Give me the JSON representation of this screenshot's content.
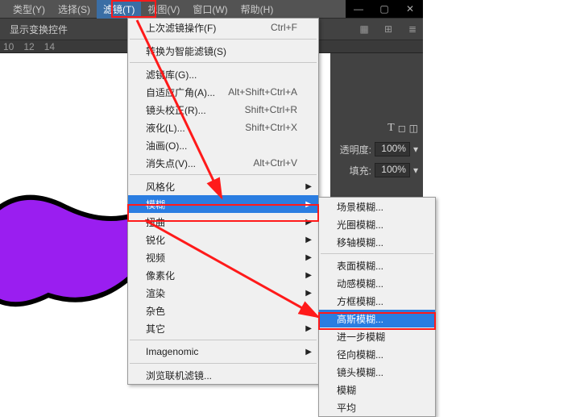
{
  "menubar": {
    "items": [
      {
        "label": "类型(Y)"
      },
      {
        "label": "选择(S)"
      },
      {
        "label": "滤镜(T)"
      },
      {
        "label": "视图(V)"
      },
      {
        "label": "窗口(W)"
      },
      {
        "label": "帮助(H)"
      }
    ]
  },
  "toolbar": {
    "label": "显示变换控件"
  },
  "ruler": {
    "marks": [
      "10",
      "12",
      "14"
    ]
  },
  "rightpanel": {
    "type_label": "T",
    "opacity_label": "透明度:",
    "opacity_value": "100%",
    "fill_label": "填充:",
    "fill_value": "100%"
  },
  "filter_menu": {
    "last_op": "上次滤镜操作(F)",
    "last_op_shortcut": "Ctrl+F",
    "smart": "转换为智能滤镜(S)",
    "gallery": "滤镜库(G)...",
    "wide": "自适应广角(A)...",
    "wide_s": "Alt+Shift+Ctrl+A",
    "lens": "镜头校正(R)...",
    "lens_s": "Shift+Ctrl+R",
    "liquify": "液化(L)...",
    "liquify_s": "Shift+Ctrl+X",
    "oil": "油画(O)...",
    "vanish": "消失点(V)...",
    "vanish_s": "Alt+Ctrl+V",
    "stylize": "风格化",
    "blur": "模糊",
    "distort": "扭曲",
    "sharpen": "锐化",
    "video": "视频",
    "pixelate": "像素化",
    "render": "渲染",
    "noise": "杂色",
    "other": "其它",
    "imagenomic": "Imagenomic",
    "browse": "浏览联机滤镜..."
  },
  "blur_menu": {
    "field": "场景模糊...",
    "iris": "光圈模糊...",
    "tilt": "移轴模糊...",
    "surface": "表面模糊...",
    "motion": "动感模糊...",
    "box": "方框模糊...",
    "gaussian": "高斯模糊...",
    "further": "进一步模糊",
    "radial": "径向模糊...",
    "lens": "镜头模糊...",
    "blur": "模糊",
    "average": "平均"
  }
}
